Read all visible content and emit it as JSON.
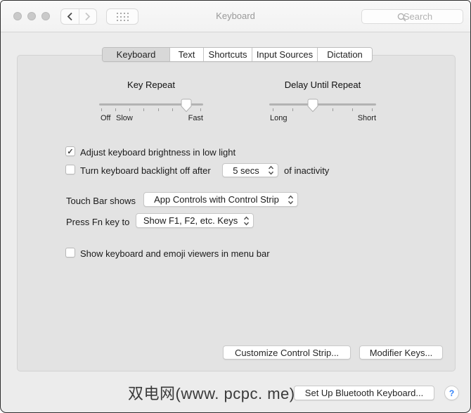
{
  "window": {
    "title": "Keyboard"
  },
  "titlebar": {
    "search_placeholder": "Search"
  },
  "tabs": [
    {
      "label": "Keyboard",
      "selected": true
    },
    {
      "label": "Text",
      "selected": false
    },
    {
      "label": "Shortcuts",
      "selected": false
    },
    {
      "label": "Input Sources",
      "selected": false
    },
    {
      "label": "Dictation",
      "selected": false
    }
  ],
  "sliders": {
    "key_repeat": {
      "title": "Key Repeat",
      "ticks": 8,
      "value_tick": 7,
      "labels": {
        "start": "Off",
        "second": "Slow",
        "end": "Fast"
      }
    },
    "delay_until_repeat": {
      "title": "Delay Until Repeat",
      "ticks": 6,
      "value_tick": 3,
      "labels": {
        "start": "Long",
        "end": "Short"
      }
    }
  },
  "checkboxes": {
    "brightness": {
      "label": "Adjust keyboard brightness in low light",
      "checked": true
    },
    "backlight": {
      "label": "Turn keyboard backlight off after",
      "checked": false,
      "suffix": "of inactivity"
    },
    "viewers": {
      "label": "Show keyboard and emoji viewers in menu bar",
      "checked": false
    }
  },
  "popups": {
    "backlight_delay": "5 secs",
    "touch_bar": "App Controls with Control Strip",
    "fn_key": "Show F1, F2, etc. Keys"
  },
  "row_labels": {
    "touch_bar": "Touch Bar shows",
    "fn_key": "Press Fn key to"
  },
  "buttons": {
    "customize_control_strip": "Customize Control Strip...",
    "modifier_keys": "Modifier Keys...",
    "setup_bluetooth": "Set Up Bluetooth Keyboard...",
    "help": "?"
  },
  "footer": {
    "watermark": "双电网(www. pcpc. me)"
  },
  "icons": {
    "checkmark": "✓"
  },
  "colors": {
    "accent_help": "#2d7ff9",
    "window_bg": "#ececec",
    "panel_bg": "#e3e3e3",
    "selected_tab_bg": "#d8d8d8"
  }
}
